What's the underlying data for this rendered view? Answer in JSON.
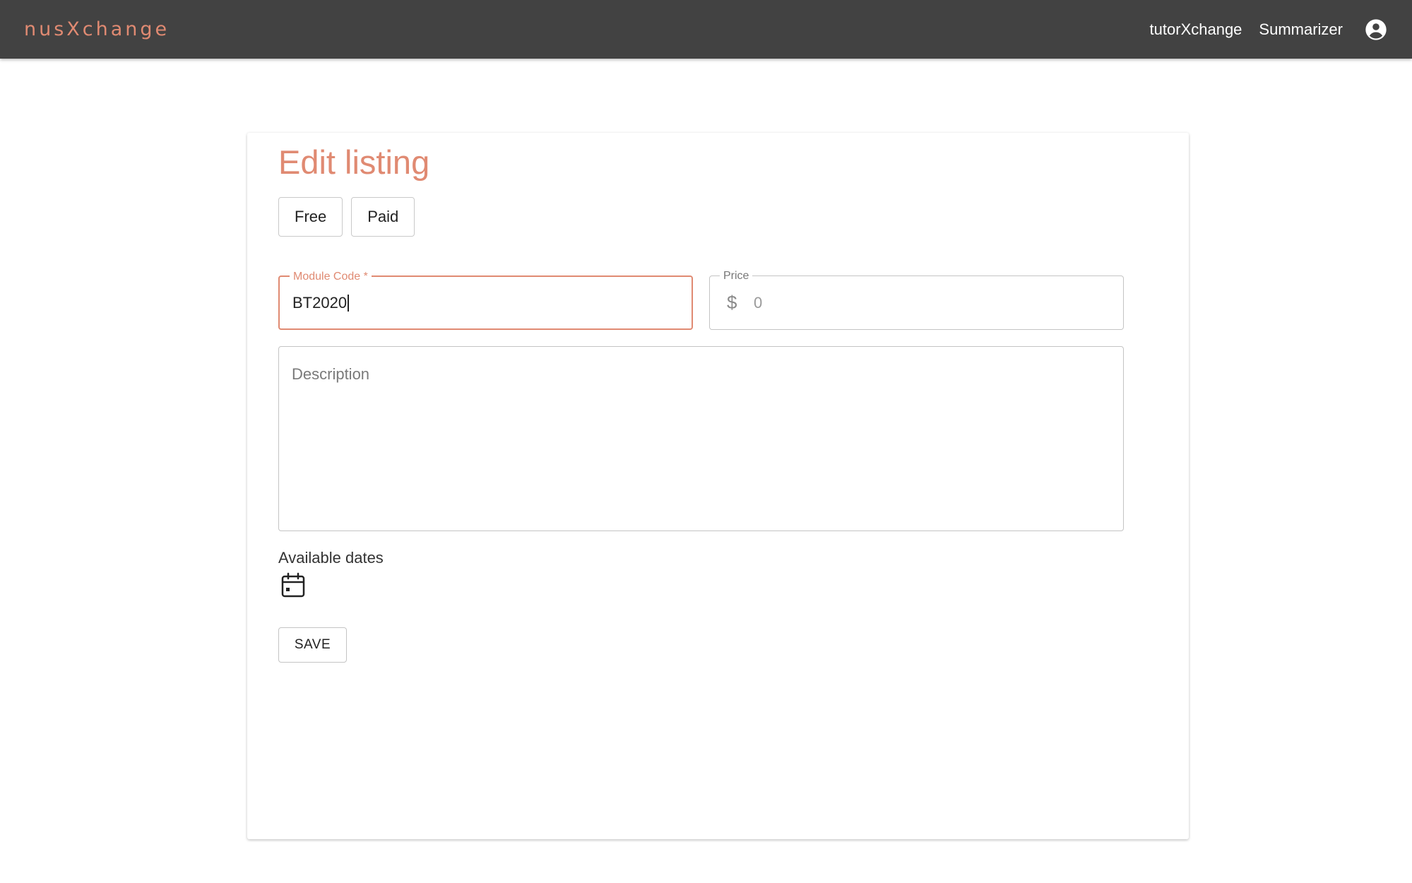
{
  "appbar": {
    "brand": "nusXchange",
    "nav": [
      {
        "label": "tutorXchange"
      },
      {
        "label": "Summarizer"
      }
    ],
    "account_icon": "account-circle-icon"
  },
  "form": {
    "title": "Edit listing",
    "pricing_toggle": [
      {
        "label": "Free"
      },
      {
        "label": "Paid"
      }
    ],
    "module_code": {
      "label": "Module Code *",
      "value": "BT2020"
    },
    "price": {
      "label": "Price",
      "currency_symbol": "$",
      "placeholder": "0"
    },
    "description": {
      "placeholder": "Description"
    },
    "available_dates": {
      "label": "Available dates",
      "icon": "calendar-icon"
    },
    "save_label": "SAVE"
  },
  "colors": {
    "accent": "#e08a72",
    "appbar_bg": "#424242"
  }
}
